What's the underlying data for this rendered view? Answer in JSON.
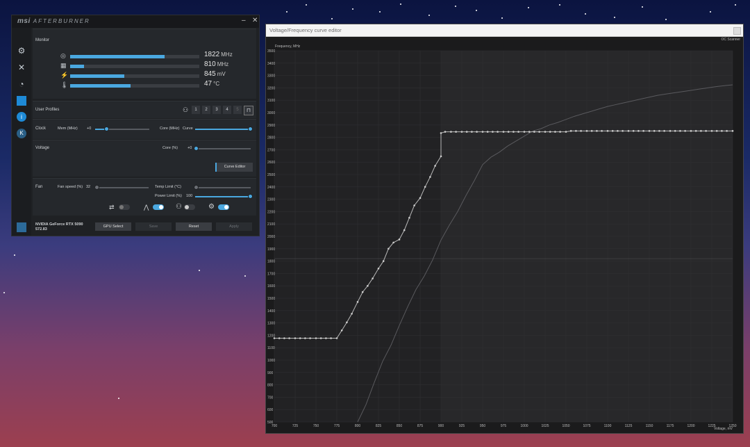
{
  "afterburner": {
    "logo": "msi",
    "logo_sub": "AFTERBURNER",
    "minimize": "–",
    "close": "✕",
    "monitor": {
      "label": "Monitor",
      "rows": [
        {
          "icon": "core-clock-icon",
          "glyph": "◎",
          "fill": 0.73,
          "value": "1822",
          "unit": "MHz"
        },
        {
          "icon": "memory-clock-icon",
          "glyph": "▦",
          "fill": 0.11,
          "value": "810",
          "unit": "MHz"
        },
        {
          "icon": "voltage-icon",
          "glyph": "⚡",
          "fill": 0.42,
          "value": "845",
          "unit": "mV"
        },
        {
          "icon": "temperature-icon",
          "glyph": "🌡",
          "fill": 0.47,
          "value": "47",
          "unit": "°C"
        }
      ]
    },
    "profiles": {
      "label": "User Profiles",
      "slots": [
        "1",
        "2",
        "3",
        "4",
        "5"
      ]
    },
    "clock": {
      "label": "Clock",
      "mem_label": "Mem (MHz)",
      "mem_value": "+0",
      "core_label": "Core (MHz)",
      "core_value": "Curve"
    },
    "voltage": {
      "label": "Voltage",
      "core_label": "Core (%)",
      "core_value": "+0",
      "curve_editor": "Curve Editor"
    },
    "fan": {
      "label": "Fan",
      "fan_speed_label": "Fan speed (%)",
      "fan_speed_value": "32",
      "temp_limit_label": "Temp Limit (°C)",
      "power_limit_label": "Power Limit (%)",
      "power_limit_value": "100"
    },
    "gpu": {
      "name": "NVIDIA GeForce RTX 5090",
      "driver": "572.83"
    },
    "buttons": {
      "gpu_select": "GPU Select",
      "save": "Save",
      "reset": "Reset",
      "apply": "Apply"
    }
  },
  "curve_editor": {
    "title": "Voltage/Frequency curve editor",
    "scanner": "OC Scanner",
    "y_axis_label": "Frequency, MHz",
    "x_axis_label": "Voltage, mV"
  },
  "chart_data": {
    "type": "line",
    "xlabel": "Voltage, mV",
    "ylabel": "Frequency, MHz",
    "xlim": [
      700,
      1250
    ],
    "ylim": [
      500,
      3500
    ],
    "x_ticks": [
      700,
      725,
      750,
      775,
      800,
      825,
      850,
      875,
      900,
      925,
      950,
      975,
      1000,
      1025,
      1050,
      1075,
      1100,
      1125,
      1150,
      1175,
      1200,
      1225,
      1250
    ],
    "y_ticks": [
      500,
      600,
      700,
      800,
      900,
      1000,
      1100,
      1200,
      1300,
      1400,
      1500,
      1600,
      1700,
      1800,
      1900,
      2000,
      2100,
      2200,
      2300,
      2400,
      2500,
      2600,
      2700,
      2800,
      2900,
      3000,
      3100,
      3200,
      3300,
      3400,
      3500
    ],
    "grid": true,
    "series": [
      {
        "role": "curve",
        "x": [
          700,
          706,
          712,
          718,
          725,
          731,
          737,
          743,
          750,
          756,
          762,
          768,
          775,
          781,
          787,
          793,
          800,
          806,
          812,
          818,
          825,
          831,
          837,
          843,
          850,
          856,
          862,
          868,
          875,
          881,
          887,
          893,
          900
        ],
        "y": [
          1177,
          1177,
          1177,
          1177,
          1177,
          1177,
          1177,
          1177,
          1177,
          1177,
          1177,
          1177,
          1177,
          1240,
          1305,
          1375,
          1470,
          1550,
          1600,
          1660,
          1740,
          1800,
          1900,
          1950,
          1975,
          2050,
          2150,
          2250,
          2310,
          2400,
          2480,
          2570,
          2647
        ],
        "x2": [
          900,
          905,
          912,
          918,
          925,
          931,
          937,
          943,
          950,
          956,
          962,
          968,
          975,
          981,
          987,
          993,
          1000,
          1006,
          1012,
          1018,
          1025,
          1031,
          1037,
          1043,
          1050,
          1056,
          1062,
          1068,
          1075,
          1081,
          1087,
          1093,
          1100,
          1106,
          1112,
          1118,
          1125,
          1131,
          1137,
          1143,
          1150,
          1156,
          1162,
          1168,
          1175,
          1181,
          1187,
          1193,
          1200,
          1206,
          1212,
          1218,
          1225,
          1231,
          1237,
          1243,
          1250
        ],
        "y2": [
          2835,
          2845,
          2845,
          2845,
          2845,
          2845,
          2845,
          2845,
          2845,
          2845,
          2845,
          2845,
          2845,
          2845,
          2845,
          2845,
          2845,
          2845,
          2845,
          2845,
          2845,
          2845,
          2845,
          2845,
          2845,
          2852,
          2852,
          2852,
          2852,
          2852,
          2852,
          2852,
          2852,
          2852,
          2852,
          2852,
          2852,
          2852,
          2852,
          2852,
          2852,
          2852,
          2852,
          2852,
          2852,
          2852,
          2852,
          2852,
          2852,
          2852,
          2852,
          2852,
          2852,
          2852,
          2852,
          2852,
          2852
        ]
      },
      {
        "role": "default-curve",
        "x": [
          800,
          810,
          820,
          830,
          840,
          850,
          860,
          870,
          880,
          890,
          900,
          910,
          920,
          930,
          940,
          950,
          960,
          970,
          980,
          990,
          1000,
          1010,
          1020,
          1030,
          1040,
          1050,
          1060,
          1070,
          1080,
          1090,
          1100,
          1110,
          1120,
          1130,
          1140,
          1150,
          1160,
          1170,
          1180,
          1190,
          1200,
          1210,
          1220,
          1230,
          1240,
          1250
        ],
        "y": [
          500,
          640,
          820,
          990,
          1120,
          1280,
          1430,
          1570,
          1680,
          1810,
          1970,
          2090,
          2200,
          2330,
          2450,
          2580,
          2640,
          2680,
          2730,
          2770,
          2810,
          2850,
          2870,
          2900,
          2920,
          2945,
          2970,
          2990,
          3010,
          3030,
          3050,
          3065,
          3080,
          3095,
          3110,
          3125,
          3140,
          3150,
          3160,
          3170,
          3180,
          3190,
          3200,
          3210,
          3218,
          3225
        ]
      }
    ]
  }
}
